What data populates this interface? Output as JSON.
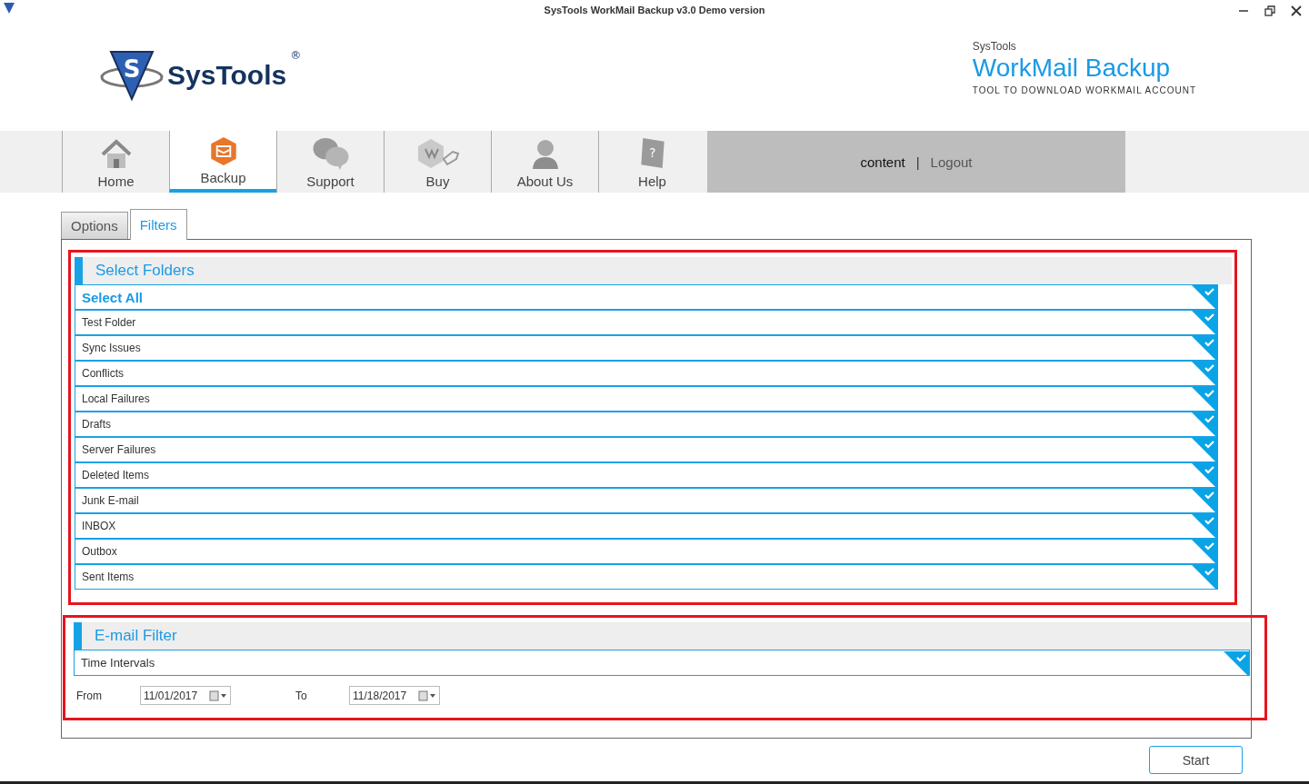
{
  "window": {
    "title": "SysTools WorkMail Backup v3.0 Demo version"
  },
  "logo": {
    "emblem": "S",
    "name": "SysTools",
    "mark": "®"
  },
  "product": {
    "vendor": "SysTools",
    "name": "WorkMail Backup",
    "tagline": "TOOL TO DOWNLOAD WORKMAIL ACCOUNT"
  },
  "nav": [
    {
      "label": "Home",
      "kind": "home",
      "selected": false
    },
    {
      "label": "Backup",
      "kind": "backup",
      "selected": true
    },
    {
      "label": "Support",
      "kind": "support",
      "selected": false
    },
    {
      "label": "Buy",
      "kind": "buy",
      "selected": false
    },
    {
      "label": "About Us",
      "kind": "about",
      "selected": false
    },
    {
      "label": "Help",
      "kind": "help",
      "glyph": "?",
      "selected": false
    }
  ],
  "account": {
    "user": "content",
    "separator": "|",
    "logout": "Logout"
  },
  "tabs": [
    {
      "label": "Options",
      "selected": false
    },
    {
      "label": "Filters",
      "selected": true
    }
  ],
  "select_folders": {
    "title": "Select Folders",
    "select_all": {
      "label": "Select All",
      "checked": true
    },
    "folders": [
      {
        "name": "Test Folder",
        "checked": true
      },
      {
        "name": "Sync Issues",
        "checked": true
      },
      {
        "name": "Conflicts",
        "checked": true
      },
      {
        "name": "Local Failures",
        "checked": true
      },
      {
        "name": "Drafts",
        "checked": true
      },
      {
        "name": "Server Failures",
        "checked": true
      },
      {
        "name": "Deleted Items",
        "checked": true
      },
      {
        "name": "Junk E-mail",
        "checked": true
      },
      {
        "name": "INBOX",
        "checked": true
      },
      {
        "name": "Outbox",
        "checked": true
      },
      {
        "name": "Sent Items",
        "checked": true
      }
    ]
  },
  "email_filter": {
    "title": "E-mail Filter",
    "time_intervals": {
      "label": "Time Intervals",
      "checked": true
    },
    "from": {
      "label": "From",
      "value": "11/01/2017"
    },
    "to": {
      "label": "To",
      "value": "11/18/2017"
    }
  },
  "buttons": {
    "start": "Start"
  }
}
